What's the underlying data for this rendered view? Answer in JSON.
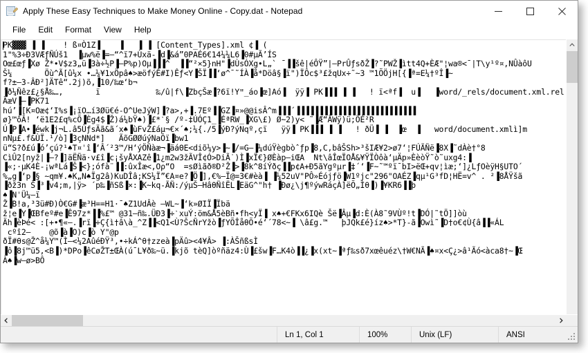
{
  "window": {
    "title": "Apply These Easy Techniques to Make Money Online - Copy.dat - Notepad",
    "icon": "notepad-icon",
    "controls": {
      "minimize": "Minimize",
      "maximize": "Maximize",
      "close": "Close"
    }
  },
  "menu": {
    "items": [
      {
        "label": "File"
      },
      {
        "label": "Edit"
      },
      {
        "label": "Format"
      },
      {
        "label": "View"
      },
      {
        "label": "Help"
      }
    ]
  },
  "editor": {
    "content": "PK▓▓▓ ▐ ▐    ! ß¤Ò1Z▐    ▐   ▐ ▐ [Content_Types].xml ¢▐ (\n1\"%3÷Ð3VÆƒÑÚš1  ▐µw%ë▐=—“^ï7+Ùxä-▐d▐&á”0PAÉ6€14¼¼L6▐0#µÃ’ÍS\nOœ£œƒ▐Xø Ž*•V$z3„ü▐3à÷½P▐—P%p)Oµ▐▐▐^  ▐▐“²×5}nH\"▐dÙsÓXg•L„` ˉ▐▐šê|éÔŸ”|—PrÛƒsðŽ▐?˜PWŽ▐ìtt4Q+ÈÆ\"¦wa®<¯|T\\y¹º¤,NÛàôU\nŠ¼       Öù^Ã[û¼x •…¼¥1xÖpâ♠>æöfýÊ#I)Êƒ<Y▐ŠÏ▐▐‘ø^¯˜ÍÀ▐å*Döâ§▐ï\")ÏÔc$³£žqUx÷˜~3 ™1ÕÖjH[{▐ª=E¼†ºÎ▐~\nf?±—3-ÂÐ²]ÄTê“.2j)õ,▐10/‰œ‘b¬\n▐ð¼Ñêz£¿§Å‰…,       ï            ‰/û|f\\▐ZbçŠæ▐?6ï!Yʺ_áo▐œ]Aó▐  ÿÿ▐ PK▐▐▐ ▐ ▐   ! ï<ªf▐  u▐   ▐word/_rels/document.xml.rel\nÄæV▐—▐PK71\nhú’▐[K¤Oæ¢‘I%s▐¡ïO…í3Øü€é-O^UeJýW]▐?a>,+▐.7Eº▐▐GZ▐¤»@@isÂ^m▐▐▐´▐▐▐▐▐▐▐▐▐▐▐▐▐▐▐▐▐▐▐▐▐▐▐▐▐▐\nø}™ôÂ! ‘ë1E2£q%cÕ▐Èg4$▐Ž)á¼bŸ♠)▐£*ˋ§ /º-‡ÚÓÇ1_▐ÉªRW_▐XG\\£) Ø~2)y< ˜▐Æ“ÂWÿ)ü;ÖÈ²R\nÚ▐P▐A•▐éwk▐j¬L.â5ÙƒsÄã&ã´x♠▐ùFvŽ£áµ¬€×´♠;¼{./5▐ýÐ?ýNqº,çï   ÿÿ▐ PK▐▐▐ ▐ ▐   ! ðÜ▐ ▐  ▐œ  ▐   word/document.xmlì]m\nnNµ£.f&ÙÏ.¹/ò]▐3çNNd*]   ÃõGØØúýNaÔï▐bw1\nü“S?ð£ú▐ó’çú?¹♠T¤ˈî▐‘Â´²3™/H‘ýÖÑàæ¬▐äáΘE<diõ¼y>▐~▐/=G—▐¼dúŸègbòˆƒp▐8,C,bâŠSh>³šIÆ¥2>ø7‘¦FÚÃÑë▐8X▐˜dÀè†°8\nCìÛ2[nyž|▐—?▐]äËÑä·v£î▐c¡šyÅXAZê▐1¿m2w3žÃVÎ¢Ó>DiÃ˙)Ì▐xÏ€}ØÈàp—iŒA  Nt\\âÎœÏOÅ&¥ŸÏÒôà‘µÄp»ÈèòŸ˜ò˜uxg4:▐\n▐«;·µK4È-¡wªLá▐Š▐<};ófà¨▐▐:ûxÎæ<,Oρ“O  =sØìãð®D²Ž▐>▐8k^8íÝðç▐▐p¢A+Ð5ãYgºµr▐‡´‘▐F~˜™ºïˉbI>ëŒ+qv¦ìæ;‘]¿LƒOèÿΗ§UTO´\n%„g▐‘p▐§ ~qm¥.♠K„N♠Ïg2â)KuDÎâ;KS¼Ï”€A¤e?▐Ö▐],€%—Ï@=3€#èà▐ ▐¼52uV\"PÔ»Éójƒö▐W1ºjc\"296\"OAÉZ▐qµ¹G³fD¦HË=v^ . ²▐8ÅŸšã\n▐ðž3n Š▐³▐v4;m,|ÿ> ´p‰▐ñSß▐×:▐K~kq-ÃÑ:/ýµŠ—HâθÑîËL▐EäG^\"h† ▐Ðø¿\\j¶ºýwRáçÀ]ëÕ„Ìθ▐)▐¥KR6▐▐þ\n♠▐NˈÜ¼—ï\nŽ▐B!a,³3ü#Ð)Ò€G#▐æ³H==H1·ˉ♠Z1UdÂè –WL~▐‘k»ØIÏ▐Ïbä\nž¦e▐Y▐ŒBfeº#e▐Ê97z*▐▐%£™ @31—ñ‰.ÜÐ3▐÷ˋxuÝ:öm&Å5èBñ•fh<yÏ▐ x♠+€FKx6IQè Šë▐Âµ▐d:È(À8˜9VÙº!t▐DÓ|˜tÖ]]òù\nÄh▐èÞé< :[+•¶«–.▐rï▐÷Ç{ì†â\\à_^Z▐▐<Q1<Ù?ŠcÑrYžò▐ƒYÕÎåθÕ•é‘´78<~▐ \\â£g.™   þJQk£é}íz♠>*T}-ã▐Owì˜▐D†o€¢Ù{â▐▐«ÁL\n cºî2–    @õ▐à▐O)c▐ò Y\"@p\nðÏ#θs@Ž^å¼Y™(Ì—<¼2AûéÐŸ³,•÷kÁ^θ†zzeà▐pÄû><4¥Â> ▐:ÀŠñßsÌ\n▐ô▐8j™ü5,<B▐)*DPo▐êCøŽT±ŒÀ(ú¯L¥ð‰~ü.▐kjõ tèQ]òºñäz4:Ù▐£šw▐F…K4ò▐▐¿▐x(xt~▐ªƒ‰sð7xœêuéz\\†W€NÃ▐♠¤x<Ç¿>â¹Ãó<àca8†~▐Œ\nÀ♠▐w—ø>BÔ"
  },
  "scrollbars": {
    "vertical": {
      "up_arrow": "chevron-up-icon",
      "down_arrow": "chevron-down-icon"
    },
    "horizontal": {
      "left_arrow": "chevron-left-icon",
      "right_arrow": "chevron-right-icon"
    }
  },
  "statusbar": {
    "position": "Ln 1, Col 1",
    "zoom": "100%",
    "line_ending": "Unix (LF)",
    "encoding": "ANSI"
  },
  "colors": {
    "window_background": "#ffffff",
    "chrome": "#f0f0f0",
    "scrollbar_thumb": "#cdcdcd",
    "border": "#9a9a9a",
    "text": "#000000"
  }
}
